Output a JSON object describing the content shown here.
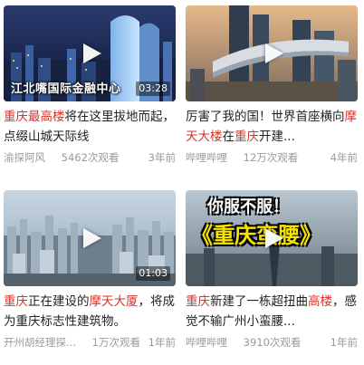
{
  "videos": [
    {
      "duration": "03:28",
      "overlay": "江北嘴国际金融中心",
      "title_parts": [
        {
          "text": "重庆",
          "hl": true
        },
        {
          "text": "最高楼",
          "hl": true
        },
        {
          "text": "将在这里拔地而起，点缀山城天际线",
          "hl": false
        }
      ],
      "author": "渝探阿风",
      "views": "5462次观看",
      "age": "3年前"
    },
    {
      "duration": "",
      "overlay": "",
      "title_parts": [
        {
          "text": "厉害了我的国！世界首座横向",
          "hl": false
        },
        {
          "text": "摩天大楼",
          "hl": true
        },
        {
          "text": "在",
          "hl": false
        },
        {
          "text": "重庆",
          "hl": true
        },
        {
          "text": "开建...",
          "hl": false
        }
      ],
      "author": "哔哩哔哩",
      "views": "12万次观看",
      "age": "4年前"
    },
    {
      "duration": "01:03",
      "overlay": "",
      "title_parts": [
        {
          "text": "重庆",
          "hl": true
        },
        {
          "text": "正在建设的",
          "hl": false
        },
        {
          "text": "摩天大厦",
          "hl": true
        },
        {
          "text": "，将成为重庆标志性建筑物。",
          "hl": false
        }
      ],
      "author": "开州胡经理探...",
      "views": "1万次观看",
      "age": "1年前"
    },
    {
      "duration": "",
      "overlay": "",
      "thumb_text_top": "你服不服！",
      "thumb_text_main": "《重庆蛮腰》",
      "title_parts": [
        {
          "text": "重庆",
          "hl": true
        },
        {
          "text": "新建了一栋超扭曲",
          "hl": false
        },
        {
          "text": "高楼",
          "hl": true
        },
        {
          "text": "，感觉不输广州小蛮腰...",
          "hl": false
        }
      ],
      "author": "哔哩哔哩",
      "views": "3910次观看",
      "age": "1年前"
    }
  ],
  "colors": {
    "highlight": "#d9342b",
    "meta": "#9a9a9a"
  }
}
